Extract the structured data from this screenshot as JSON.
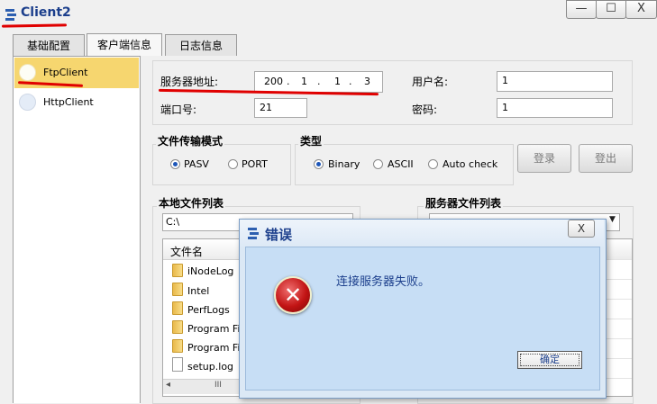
{
  "window": {
    "title": "Client2",
    "controls": {
      "minimize": "—",
      "maximize": "☐",
      "close": "X"
    }
  },
  "tabs": [
    "基础配置",
    "客户端信息",
    "日志信息"
  ],
  "active_tab": "客户端信息",
  "sidebar": {
    "items": [
      {
        "label": "FtpClient",
        "selected": true
      },
      {
        "label": "HttpClient",
        "selected": false
      }
    ]
  },
  "server": {
    "address_label": "服务器地址:",
    "ip_octets": [
      "200",
      "1",
      "1",
      "3"
    ],
    "ip_separator": ".",
    "port_label": "端口号:",
    "port_value": "21",
    "username_label": "用户名:",
    "username_value": "1",
    "password_label": "密码:",
    "password_value": "1"
  },
  "transfer_mode": {
    "title": "文件传输模式",
    "options": [
      "PASV",
      "PORT"
    ],
    "selected": "PASV"
  },
  "file_type": {
    "title": "类型",
    "options": [
      "Binary",
      "ASCII",
      "Auto check"
    ],
    "selected": "Binary"
  },
  "buttons": {
    "login": "登录",
    "logout": "登出"
  },
  "local_files": {
    "title": "本地文件列表",
    "path": "C:\\",
    "column_header": "文件名",
    "items": [
      {
        "name": "iNodeLog",
        "type": "folder"
      },
      {
        "name": "Intel",
        "type": "folder"
      },
      {
        "name": "PerfLogs",
        "type": "folder"
      },
      {
        "name": "Program File",
        "type": "folder"
      },
      {
        "name": "Program File",
        "type": "folder"
      },
      {
        "name": "setup.log",
        "type": "file"
      }
    ],
    "scrollbar": {
      "left": "◂",
      "grip": "III",
      "right": "▸"
    }
  },
  "server_files": {
    "title": "服务器文件列表"
  },
  "dialog": {
    "title": "错误",
    "close_label": "X",
    "message": "连接服务器失败。",
    "ok_label": "确定",
    "icon": "error-icon"
  },
  "colors": {
    "annotation_red": "#e00000",
    "selected_nav": "#f6d66f",
    "dialog_bg": "#c7def5",
    "title_blue": "#1c3f8c"
  }
}
